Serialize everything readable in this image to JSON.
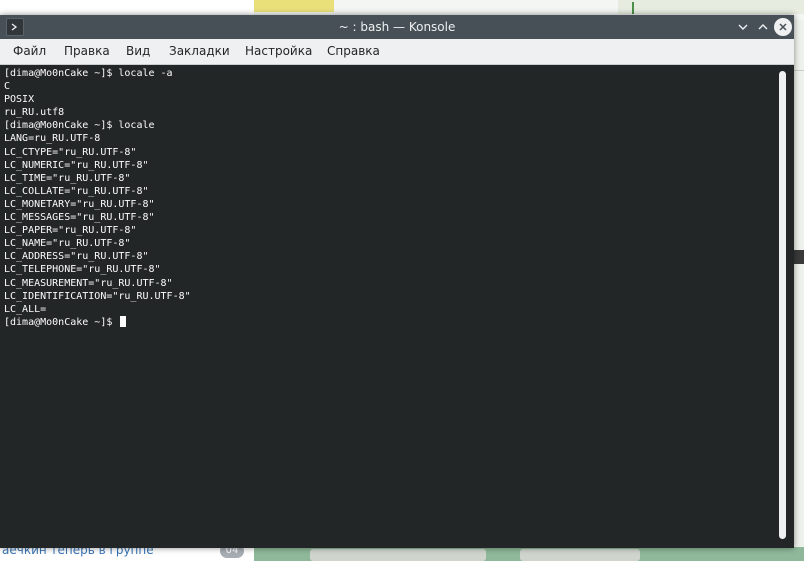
{
  "window": {
    "title": "~ : bash — Konsole"
  },
  "menu": [
    "Файл",
    "Правка",
    "Вид",
    "Закладки",
    "Настройка",
    "Справка"
  ],
  "terminal": {
    "lines": [
      "[dima@Mo0nCake ~]$ locale -a",
      "C",
      "POSIX",
      "ru_RU.utf8",
      "[dima@Mo0nCake ~]$ locale",
      "LANG=ru_RU.UTF-8",
      "LC_CTYPE=\"ru_RU.UTF-8\"",
      "LC_NUMERIC=\"ru_RU.UTF-8\"",
      "LC_TIME=\"ru_RU.UTF-8\"",
      "LC_COLLATE=\"ru_RU.UTF-8\"",
      "LC_MONETARY=\"ru_RU.UTF-8\"",
      "LC_MESSAGES=\"ru_RU.UTF-8\"",
      "LC_PAPER=\"ru_RU.UTF-8\"",
      "LC_NAME=\"ru_RU.UTF-8\"",
      "LC_ADDRESS=\"ru_RU.UTF-8\"",
      "LC_TELEPHONE=\"ru_RU.UTF-8\"",
      "LC_MEASUREMENT=\"ru_RU.UTF-8\"",
      "LC_IDENTIFICATION=\"ru_RU.UTF-8\"",
      "LC_ALL="
    ],
    "prompt": "[dima@Mo0nCake ~]$ "
  },
  "background": {
    "chat_preview": "аечкин теперь в группе",
    "badge": "04"
  },
  "colors": {
    "terminal_bg": "#232627",
    "terminal_fg": "#fcfcfc",
    "titlebar": "#475057",
    "menubar": "#eff0f1"
  }
}
